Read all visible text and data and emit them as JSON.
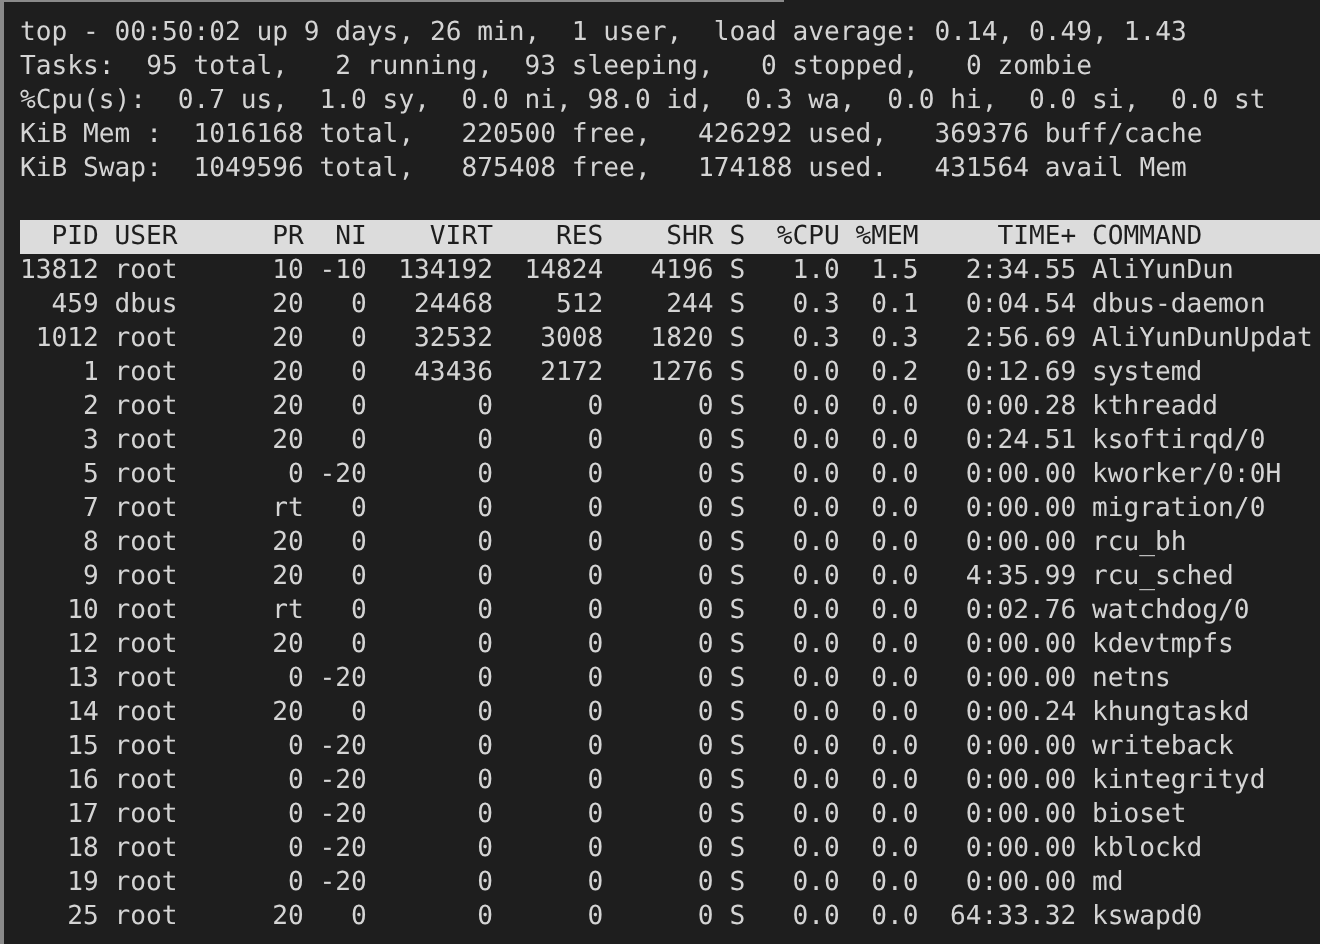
{
  "summary_lines": [
    "top - 00:50:02 up 9 days, 26 min,  1 user,  load average: 0.14, 0.49, 1.43",
    "Tasks:  95 total,   2 running,  93 sleeping,   0 stopped,   0 zombie",
    "%Cpu(s):  0.7 us,  1.0 sy,  0.0 ni, 98.0 id,  0.3 wa,  0.0 hi,  0.0 si,  0.0 st",
    "KiB Mem :  1016168 total,   220500 free,   426292 used,   369376 buff/cache",
    "KiB Swap:  1049596 total,   875408 free,   174188 used.   431564 avail Mem"
  ],
  "table": {
    "columns": [
      "PID",
      "USER",
      "PR",
      "NI",
      "VIRT",
      "RES",
      "SHR",
      "S",
      "%CPU",
      "%MEM",
      "TIME+",
      "COMMAND"
    ],
    "rows": [
      [
        "13812",
        "root",
        "10",
        "-10",
        "134192",
        "14824",
        "4196",
        "S",
        "1.0",
        "1.5",
        "2:34.55",
        "AliYunDun"
      ],
      [
        "459",
        "dbus",
        "20",
        "0",
        "24468",
        "512",
        "244",
        "S",
        "0.3",
        "0.1",
        "0:04.54",
        "dbus-daemon"
      ],
      [
        "1012",
        "root",
        "20",
        "0",
        "32532",
        "3008",
        "1820",
        "S",
        "0.3",
        "0.3",
        "2:56.69",
        "AliYunDunUpdat"
      ],
      [
        "1",
        "root",
        "20",
        "0",
        "43436",
        "2172",
        "1276",
        "S",
        "0.0",
        "0.2",
        "0:12.69",
        "systemd"
      ],
      [
        "2",
        "root",
        "20",
        "0",
        "0",
        "0",
        "0",
        "S",
        "0.0",
        "0.0",
        "0:00.28",
        "kthreadd"
      ],
      [
        "3",
        "root",
        "20",
        "0",
        "0",
        "0",
        "0",
        "S",
        "0.0",
        "0.0",
        "0:24.51",
        "ksoftirqd/0"
      ],
      [
        "5",
        "root",
        "0",
        "-20",
        "0",
        "0",
        "0",
        "S",
        "0.0",
        "0.0",
        "0:00.00",
        "kworker/0:0H"
      ],
      [
        "7",
        "root",
        "rt",
        "0",
        "0",
        "0",
        "0",
        "S",
        "0.0",
        "0.0",
        "0:00.00",
        "migration/0"
      ],
      [
        "8",
        "root",
        "20",
        "0",
        "0",
        "0",
        "0",
        "S",
        "0.0",
        "0.0",
        "0:00.00",
        "rcu_bh"
      ],
      [
        "9",
        "root",
        "20",
        "0",
        "0",
        "0",
        "0",
        "S",
        "0.0",
        "0.0",
        "4:35.99",
        "rcu_sched"
      ],
      [
        "10",
        "root",
        "rt",
        "0",
        "0",
        "0",
        "0",
        "S",
        "0.0",
        "0.0",
        "0:02.76",
        "watchdog/0"
      ],
      [
        "12",
        "root",
        "20",
        "0",
        "0",
        "0",
        "0",
        "S",
        "0.0",
        "0.0",
        "0:00.00",
        "kdevtmpfs"
      ],
      [
        "13",
        "root",
        "0",
        "-20",
        "0",
        "0",
        "0",
        "S",
        "0.0",
        "0.0",
        "0:00.00",
        "netns"
      ],
      [
        "14",
        "root",
        "20",
        "0",
        "0",
        "0",
        "0",
        "S",
        "0.0",
        "0.0",
        "0:00.24",
        "khungtaskd"
      ],
      [
        "15",
        "root",
        "0",
        "-20",
        "0",
        "0",
        "0",
        "S",
        "0.0",
        "0.0",
        "0:00.00",
        "writeback"
      ],
      [
        "16",
        "root",
        "0",
        "-20",
        "0",
        "0",
        "0",
        "S",
        "0.0",
        "0.0",
        "0:00.00",
        "kintegrityd"
      ],
      [
        "17",
        "root",
        "0",
        "-20",
        "0",
        "0",
        "0",
        "S",
        "0.0",
        "0.0",
        "0:00.00",
        "bioset"
      ],
      [
        "18",
        "root",
        "0",
        "-20",
        "0",
        "0",
        "0",
        "S",
        "0.0",
        "0.0",
        "0:00.00",
        "kblockd"
      ],
      [
        "19",
        "root",
        "0",
        "-20",
        "0",
        "0",
        "0",
        "S",
        "0.0",
        "0.0",
        "0:00.00",
        "md"
      ],
      [
        "25",
        "root",
        "20",
        "0",
        "0",
        "0",
        "0",
        "S",
        "0.0",
        "0.0",
        "64:33.32",
        "kswapd0"
      ]
    ]
  }
}
